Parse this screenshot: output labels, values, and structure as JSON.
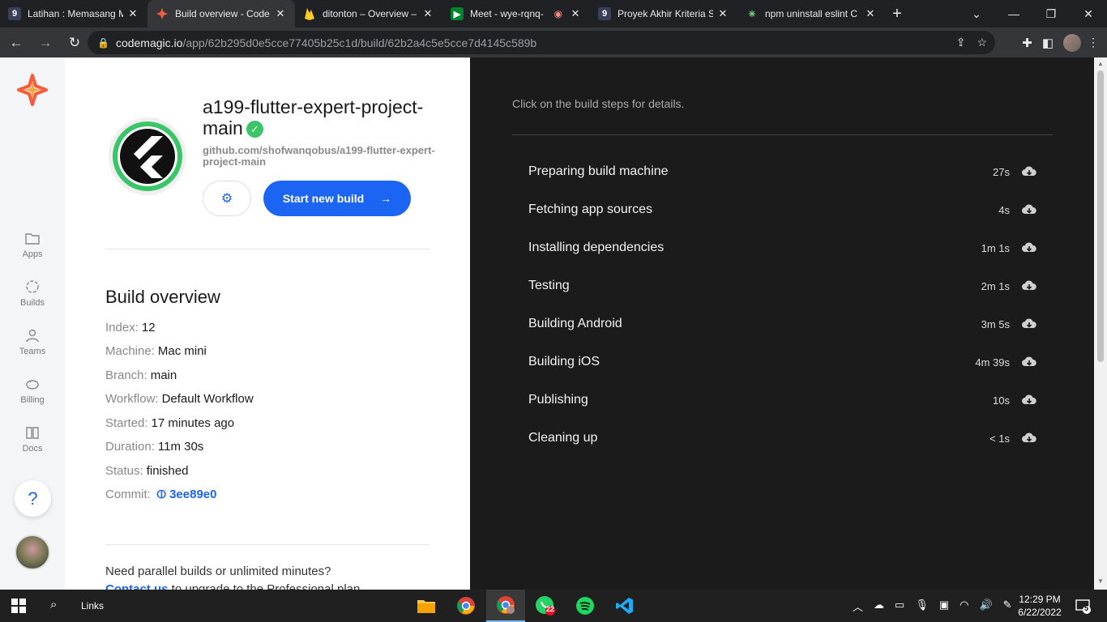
{
  "browser": {
    "tabs": [
      {
        "title": "Latihan : Memasang M",
        "favicon": "dicoding-icon",
        "active": false
      },
      {
        "title": "Build overview - Code",
        "favicon": "codemagic-icon",
        "active": true
      },
      {
        "title": "ditonton – Overview –",
        "favicon": "firebase-icon",
        "active": false
      },
      {
        "title": "Meet - wye-rqnq-",
        "favicon": "meet-icon",
        "active": false
      },
      {
        "title": "Proyek Akhir Kriteria S",
        "favicon": "dicoding-icon",
        "active": false
      },
      {
        "title": "npm uninstall eslint C",
        "favicon": "perplexity-icon",
        "active": false
      }
    ],
    "url_host": "codemagic.io",
    "url_path": "/app/62b295d0e5cce77405b25c1d/build/62b2a4c5e5cce7d4145c589b"
  },
  "sidebar": {
    "items": [
      {
        "label": "Apps",
        "icon": "folder-icon"
      },
      {
        "label": "Builds",
        "icon": "builds-icon"
      },
      {
        "label": "Teams",
        "icon": "person-icon"
      },
      {
        "label": "Billing",
        "icon": "piggy-bank-icon"
      },
      {
        "label": "Docs",
        "icon": "book-icon"
      }
    ],
    "help_label": "?"
  },
  "app": {
    "name": "a199-flutter-expert-project-main",
    "repo": "github.com/shofwanqobus/a199-flutter-expert-project-main",
    "start_build_label": "Start new build"
  },
  "overview": {
    "title": "Build overview",
    "rows": [
      {
        "label": "Index:",
        "value": "12"
      },
      {
        "label": "Machine:",
        "value": "Mac mini"
      },
      {
        "label": "Branch:",
        "value": "main"
      },
      {
        "label": "Workflow:",
        "value": "Default Workflow"
      },
      {
        "label": "Started:",
        "value": "17 minutes ago"
      },
      {
        "label": "Duration:",
        "value": "11m 30s"
      },
      {
        "label": "Status:",
        "value": "finished"
      }
    ],
    "commit_label": "Commit:",
    "commit_value": "3ee89e0",
    "promo_text": "Need parallel builds or unlimited minutes?",
    "promo_link": "Contact us",
    "promo_rest": " to upgrade to the Professional plan"
  },
  "steps_panel": {
    "hint": "Click on the build steps for details.",
    "steps": [
      {
        "name": "Preparing build machine",
        "duration": "27s"
      },
      {
        "name": "Fetching app sources",
        "duration": "4s"
      },
      {
        "name": "Installing dependencies",
        "duration": "1m 1s"
      },
      {
        "name": "Testing",
        "duration": "2m 1s"
      },
      {
        "name": "Building Android",
        "duration": "3m 5s"
      },
      {
        "name": "Building iOS",
        "duration": "4m 39s"
      },
      {
        "name": "Publishing",
        "duration": "10s"
      },
      {
        "name": "Cleaning up",
        "duration": "< 1s"
      }
    ]
  },
  "taskbar": {
    "links_label": "Links",
    "whatsapp_badge": "22",
    "time": "12:29 PM",
    "date": "6/22/2022",
    "notifications": "5"
  },
  "colors": {
    "accent": "#1c64f2",
    "success": "#3ac569",
    "dark_panel": "#1b1b1c"
  }
}
